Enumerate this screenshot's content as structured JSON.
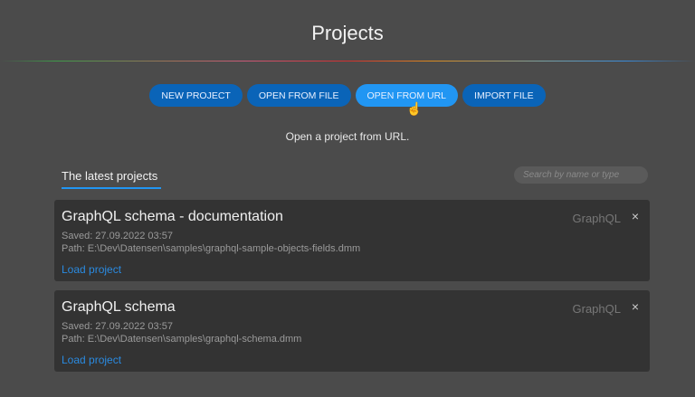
{
  "header": {
    "title": "Projects"
  },
  "actions": [
    {
      "label": "NEW PROJECT"
    },
    {
      "label": "OPEN FROM FILE"
    },
    {
      "label": "OPEN FROM URL"
    },
    {
      "label": "IMPORT FILE"
    }
  ],
  "hint": "Open a project from URL.",
  "latest": {
    "tab": "The latest projects",
    "search_placeholder": "Search by name or type"
  },
  "projects": [
    {
      "name": "GraphQL schema - documentation",
      "type": "GraphQL",
      "saved": "Saved: 27.09.2022 03:57",
      "path": "Path: E:\\Dev\\Datensen\\samples\\graphql-sample-objects-fields.dmm",
      "load": "Load project",
      "close": "×"
    },
    {
      "name": "GraphQL schema",
      "type": "GraphQL",
      "saved": "Saved: 27.09.2022 03:57",
      "path": "Path: E:\\Dev\\Datensen\\samples\\graphql-schema.dmm",
      "load": "Load project",
      "close": "×"
    }
  ],
  "colors": {
    "accent": "#2196f3",
    "button": "#0a64b8",
    "card": "#333333",
    "background": "#4b4b4b"
  }
}
